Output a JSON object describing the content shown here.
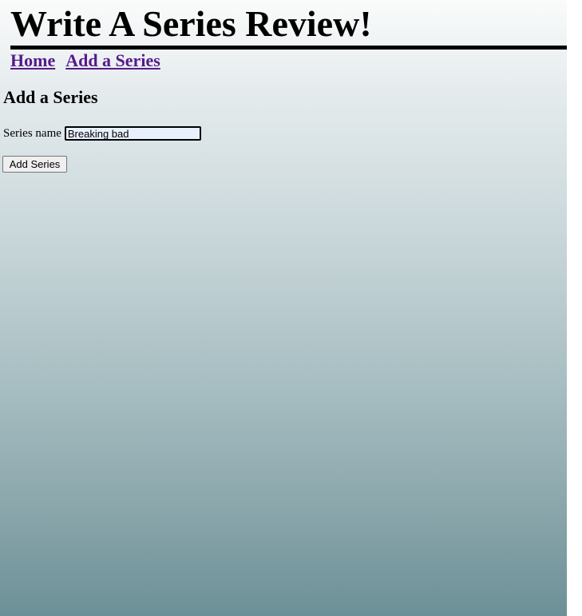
{
  "header": {
    "title": "Write A Series Review!"
  },
  "nav": {
    "items": [
      {
        "label": "Home"
      },
      {
        "label": "Add a Series"
      }
    ]
  },
  "main": {
    "heading": "Add a Series",
    "form": {
      "series_name_label": "Series name",
      "series_name_value": "Breaking bad",
      "submit_label": "Add Series"
    }
  },
  "colors": {
    "link": "#551a8b",
    "gradient_top": "#fafbfb",
    "gradient_bottom": "#6c9097",
    "input_bg": "#e8f0fe"
  }
}
